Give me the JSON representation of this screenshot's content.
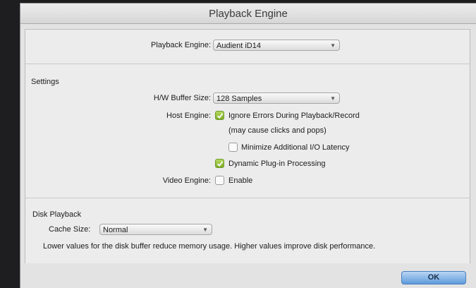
{
  "window": {
    "title": "Playback Engine"
  },
  "engine": {
    "label": "Playback Engine:",
    "value": "Audient iD14"
  },
  "settings": {
    "heading": "Settings",
    "buffer": {
      "label": "H/W Buffer Size:",
      "value": "128 Samples"
    },
    "host_engine": {
      "label": "Host Engine:",
      "ignore_errors": {
        "label": "Ignore Errors During Playback/Record",
        "checked": true
      },
      "ignore_errors_note": "(may cause clicks and pops)",
      "minimize_latency": {
        "label": "Minimize Additional I/O Latency",
        "checked": false
      },
      "dynamic_plugin": {
        "label": "Dynamic Plug-in Processing",
        "checked": true
      }
    },
    "video_engine": {
      "label": "Video Engine:",
      "enable": {
        "label": "Enable",
        "checked": false
      }
    }
  },
  "disk": {
    "heading": "Disk Playback",
    "cache": {
      "label": "Cache Size:",
      "value": "Normal"
    },
    "note": "Lower values for the disk buffer reduce memory usage.  Higher values improve disk performance."
  },
  "footer": {
    "ok_label": "OK"
  },
  "colors": {
    "check_on": "#8dbb3a",
    "ok_button": "#6ea6e0"
  }
}
